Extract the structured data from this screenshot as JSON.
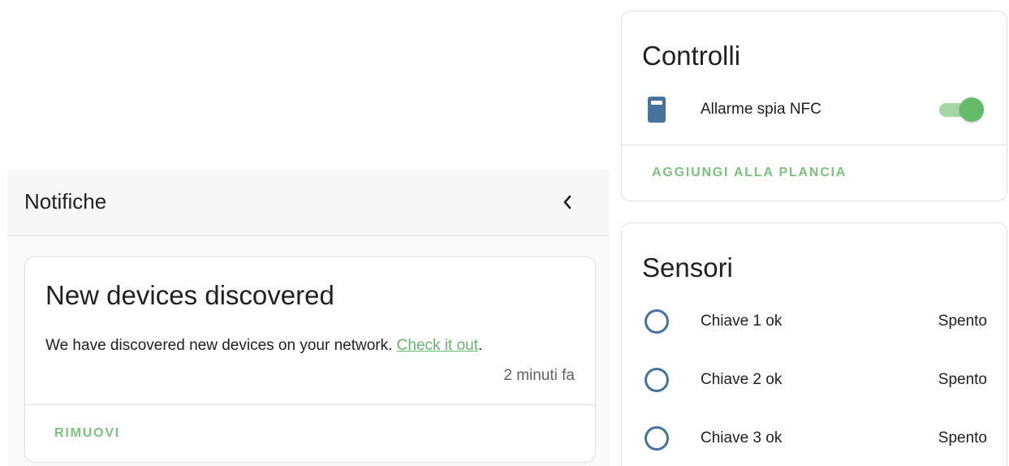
{
  "notifications": {
    "title": "Notifiche",
    "collapse_icon": "chevron-left-icon",
    "card": {
      "title": "New devices discovered",
      "message_prefix": "We have discovered new devices on your network. ",
      "link_text": "Check it out",
      "message_suffix": ".",
      "time": "2 minuti fa",
      "dismiss_label": "RIMUOVI"
    }
  },
  "controls": {
    "title": "Controlli",
    "entity": {
      "name": "Allarme spia NFC",
      "icon": "nfc-card-icon",
      "state": "on"
    },
    "add_label": "AGGIUNGI ALLA PLANCIA"
  },
  "sensors": {
    "title": "Sensori",
    "items": [
      {
        "name": "Chiave 1 ok",
        "state": "Spento",
        "icon": "circle-outline-icon"
      },
      {
        "name": "Chiave 2 ok",
        "state": "Spento",
        "icon": "circle-outline-icon"
      },
      {
        "name": "Chiave 3 ok",
        "state": "Spento",
        "icon": "circle-outline-icon"
      }
    ]
  },
  "colors": {
    "accent_green": "#7cc17f",
    "link_green": "#68b56e",
    "icon_blue": "#44739e"
  }
}
